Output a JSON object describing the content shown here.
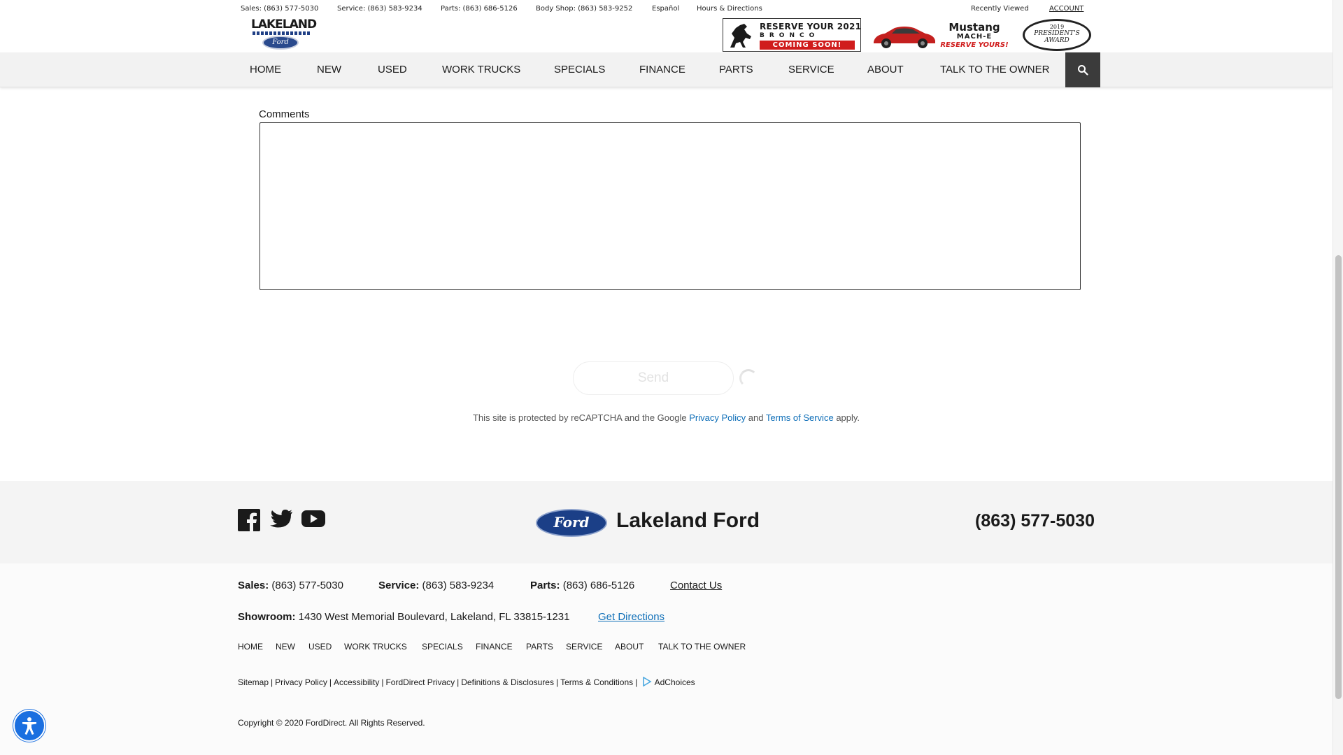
{
  "utility": {
    "sales": "Sales: (863) 577-5030",
    "service": "Service: (863) 583-9234",
    "parts": "Parts: (863) 686-5126",
    "body_shop": "Body Shop: (863) 583-9252",
    "espanol": "Español",
    "hours": "Hours & Directions",
    "recently_viewed": "Recently Viewed",
    "account": "ACCOUNT"
  },
  "logo": {
    "word": "LAKELAND",
    "oval": "Ford"
  },
  "banners": {
    "bronco": {
      "line1": "RESERVE YOUR 2021",
      "line2": "BRONCO",
      "line3": "COMING SOON!"
    },
    "mach": {
      "title": "Mustang",
      "sub": "MACH-E",
      "cta": "RESERVE YOURS!"
    },
    "award": {
      "year": "2019",
      "line1": "PRESIDENT'S",
      "line2": "AWARD"
    }
  },
  "nav": {
    "items": [
      "HOME",
      "NEW",
      "USED",
      "WORK TRUCKS",
      "SPECIALS",
      "FINANCE",
      "PARTS",
      "SERVICE",
      "ABOUT",
      "TALK TO THE OWNER"
    ],
    "search_icon": "search-icon"
  },
  "form": {
    "comments_label": "Comments",
    "comments_value": "",
    "send_label": "Send"
  },
  "recaptcha": {
    "prefix": "This site is protected by reCAPTCHA and the Google",
    "privacy": "Privacy Policy",
    "and": "and",
    "terms": "Terms of Service",
    "suffix": "apply."
  },
  "footer": {
    "social": [
      "facebook-icon",
      "twitter-icon",
      "youtube-icon"
    ],
    "ford_oval": "Ford",
    "brand": "Lakeland Ford",
    "phone": "(863) 577-5030",
    "sales_label": "Sales:",
    "sales_value": "(863) 577-5030",
    "service_label": "Service:",
    "service_value": "(863) 583-9234",
    "parts_label": "Parts:",
    "parts_value": "(863) 686-5126",
    "contact": "Contact Us",
    "showroom_label": "Showroom:",
    "showroom_value": "1430 West Memorial Boulevard, Lakeland, FL 33815-1231",
    "directions": "Get Directions",
    "nav": [
      "HOME",
      "NEW",
      "USED",
      "WORK TRUCKS",
      "SPECIALS",
      "FINANCE",
      "PARTS",
      "SERVICE",
      "ABOUT",
      "TALK TO THE OWNER"
    ],
    "legal": [
      "Sitemap",
      "Privacy Policy",
      "Accessibility",
      "FordDirect Privacy",
      "Definitions & Disclosures",
      "Terms & Conditions"
    ],
    "adchoices": "AdChoices",
    "copyright": "Copyright © 2020 FordDirect. All Rights Reserved."
  },
  "colors": {
    "link_blue": "#0f6fb8",
    "nav_bg": "#f2f2f2",
    "search_bg": "#3b3b3b",
    "a11y_blue": "#1a6fe0",
    "accent_red": "#d01c1c"
  }
}
